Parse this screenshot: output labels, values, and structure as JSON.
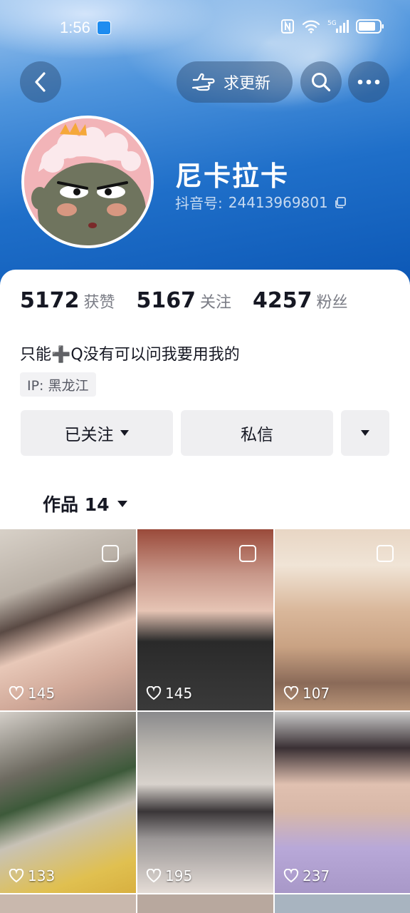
{
  "status_bar": {
    "time": "1:56",
    "network": "5G"
  },
  "header": {
    "update_label": "求更新"
  },
  "profile": {
    "name": "尼卡拉卡",
    "id_label": "抖音号:",
    "id_value": "24413969801",
    "stats": [
      {
        "value": "5172",
        "label": "获赞"
      },
      {
        "value": "5167",
        "label": "关注"
      },
      {
        "value": "4257",
        "label": "粉丝"
      }
    ],
    "bio": "只能➕Q没有可以问我要用我的",
    "ip": "IP:  黑龙江"
  },
  "actions": {
    "follow_label": "已关注",
    "message_label": "私信"
  },
  "tabs": {
    "works_label": "作品 14"
  },
  "videos": [
    {
      "likes": "145"
    },
    {
      "likes": "145"
    },
    {
      "likes": "107"
    },
    {
      "likes": "133"
    },
    {
      "likes": "195"
    },
    {
      "likes": "237"
    }
  ],
  "colors": {
    "banner": "#1f6fc9",
    "button_bg": "#efeff1",
    "text_primary": "#161823",
    "text_secondary": "#7a7c85"
  }
}
